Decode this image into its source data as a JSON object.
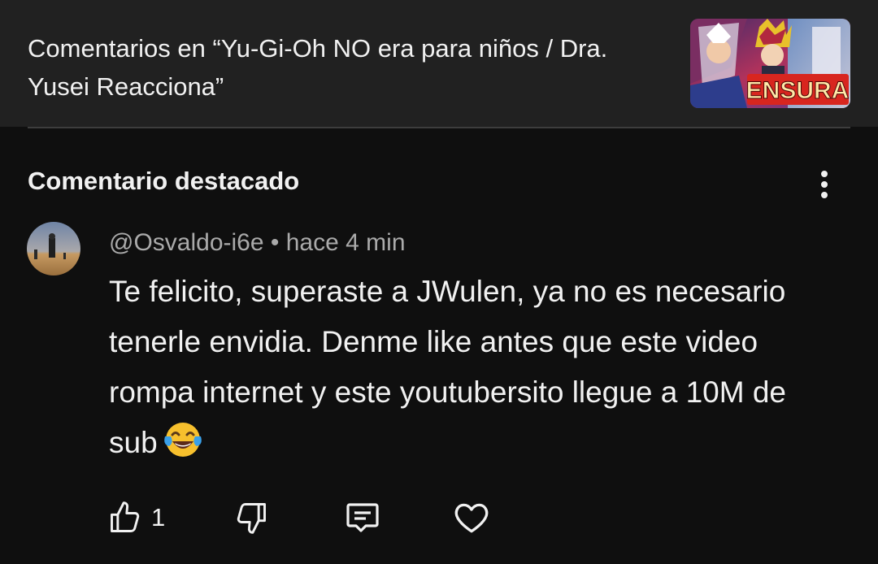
{
  "header": {
    "title": "Comentarios en “Yu-Gi-Oh NO era para niños / Dra. Yusei Reacciona”",
    "thumbnail_text": "ENSURA"
  },
  "section": {
    "title": "Comentario destacado"
  },
  "comment": {
    "author": "@Osvaldo-i6e",
    "separator": "•",
    "time": "hace 4 min",
    "text": "Te felicito, superaste a JWulen, ya no es necesario tenerle envidia. Denme like antes que este video rompa internet y este youtubersito llegue a 10M de sub",
    "emoji": "face-with-tears-of-joy",
    "like_count": "1"
  },
  "icons": {
    "like": "thumbs-up-icon",
    "dislike": "thumbs-down-icon",
    "reply": "reply-icon",
    "heart": "heart-icon",
    "more": "more-vertical-icon"
  },
  "colors": {
    "background": "#0f0f0f",
    "header_background": "#212121",
    "text": "#f1f1f1",
    "secondary_text": "#aaaaaa",
    "thumb_banner": "#d8261f"
  }
}
